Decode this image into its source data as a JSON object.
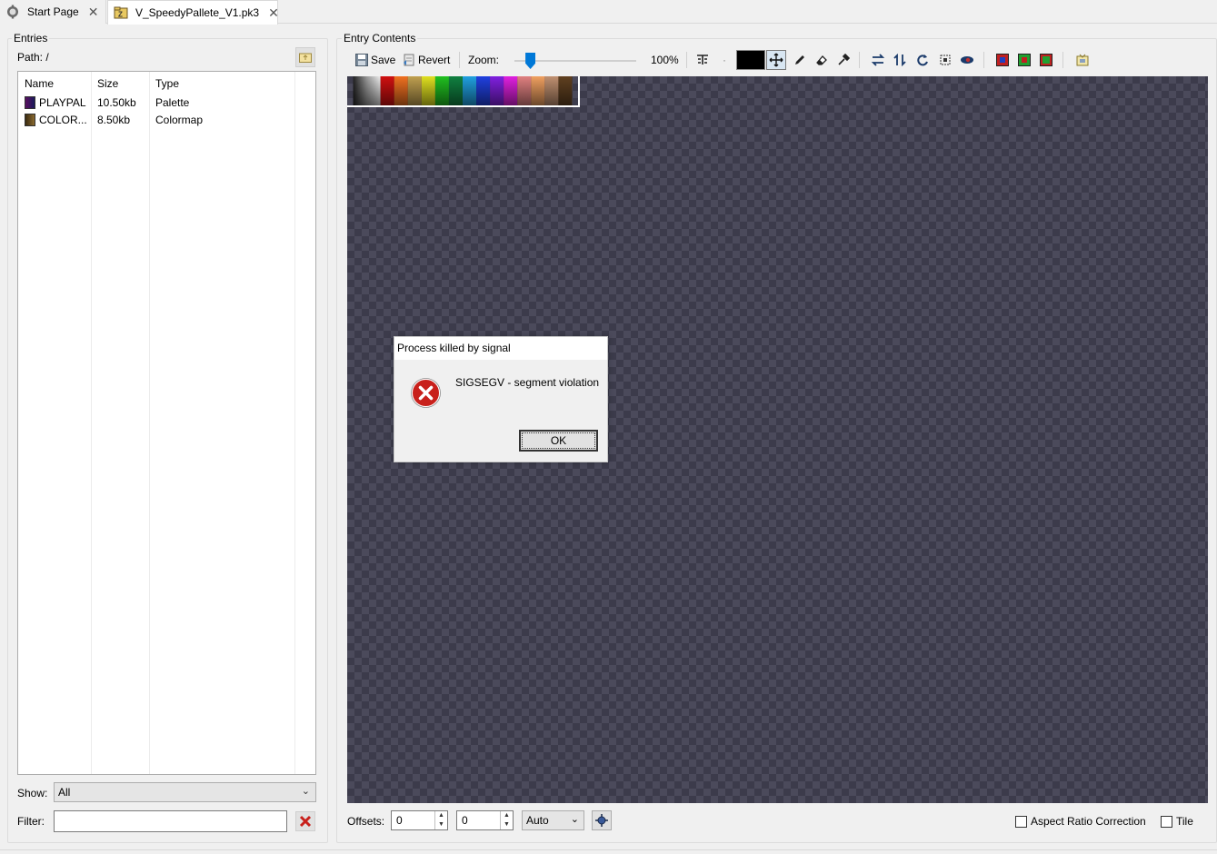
{
  "tabs": [
    {
      "label": "Start Page",
      "icon": "gear-icon"
    },
    {
      "label": "V_SpeedyPallete_V1.pk3",
      "icon": "archive-icon"
    }
  ],
  "entries": {
    "group_label": "Entries",
    "path": "Path: /",
    "columns": [
      "Name",
      "Size",
      "Type"
    ],
    "rows": [
      {
        "name": "PLAYPAL",
        "size": "10.50kb",
        "type": "Palette"
      },
      {
        "name": "COLOR...",
        "size": "8.50kb",
        "type": "Colormap"
      }
    ],
    "show_label": "Show:",
    "show_value": "All",
    "filter_label": "Filter:",
    "filter_value": ""
  },
  "contents": {
    "group_label": "Entry Contents",
    "save_label": "Save",
    "revert_label": "Revert",
    "zoom_label": "Zoom:",
    "zoom_value": "100%",
    "zoom_fraction": 0.12,
    "paint_color": "#000000"
  },
  "bottom": {
    "offsets_label": "Offsets:",
    "offset_x": "0",
    "offset_y": "0",
    "offset_mode": "Auto",
    "aspect_label": "Aspect Ratio Correction",
    "tile_label": "Tile"
  },
  "dialog": {
    "title": "Process killed by signal",
    "message": "SIGSEGV - segment violation",
    "ok_label": "OK"
  },
  "colors": {
    "canvas_dark": "#3c3b4b",
    "canvas_light": "#4b4a5b",
    "accent": "#0078d7",
    "error_red": "#c8201b"
  }
}
